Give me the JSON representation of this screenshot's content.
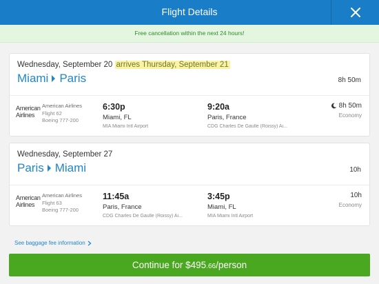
{
  "header": {
    "title": "Flight Details",
    "close_icon": "close-icon"
  },
  "banner": {
    "text": "Free cancellation within the next 24 hours!"
  },
  "colors": {
    "header": "#1a7dc7",
    "link": "#1f86c8",
    "continue": "#49a81f",
    "banner_bg": "#e4f6df",
    "banner_text": "#2f8a2a",
    "highlight": "#fbf2a4"
  },
  "trips": [
    {
      "date": "Wednesday, September 20",
      "arrives_note": "arrives Thursday, September 21",
      "origin": "Miami",
      "destination": "Paris",
      "total_duration": "8h 50m",
      "segment": {
        "logo_line1": "American",
        "logo_line2": "Airlines",
        "airline": "American Airlines",
        "flight": "Flight 62",
        "aircraft": "Boeing 777-200",
        "dep_time": "6:30p",
        "dep_city": "Miami, FL",
        "dep_airport": "MIA Miami Intl Airport",
        "arr_time": "9:20a",
        "arr_city": "Paris, France",
        "arr_airport": "CDG Charles De Gaulle (Roissy) Ai...",
        "duration": "8h 50m",
        "overnight_icon": "moon-icon",
        "cabin": "Economy"
      }
    },
    {
      "date": "Wednesday, September 27",
      "arrives_note": "",
      "origin": "Paris",
      "destination": "Miami",
      "total_duration": "10h",
      "segment": {
        "logo_line1": "American",
        "logo_line2": "Airlines",
        "airline": "American Airlines",
        "flight": "Flight 63",
        "aircraft": "Boeing 777-200",
        "dep_time": "11:45a",
        "dep_city": "Paris, France",
        "dep_airport": "CDG Charles De Gaulle (Roissy) Ai...",
        "arr_time": "3:45p",
        "arr_city": "Miami, FL",
        "arr_airport": "MIA Miami Intl Airport",
        "duration": "10h",
        "cabin": "Economy"
      }
    }
  ],
  "baggage_link": "See baggage fee information",
  "continue": {
    "prefix": "Continue for $495",
    "cents": ".66",
    "suffix": "/person"
  }
}
